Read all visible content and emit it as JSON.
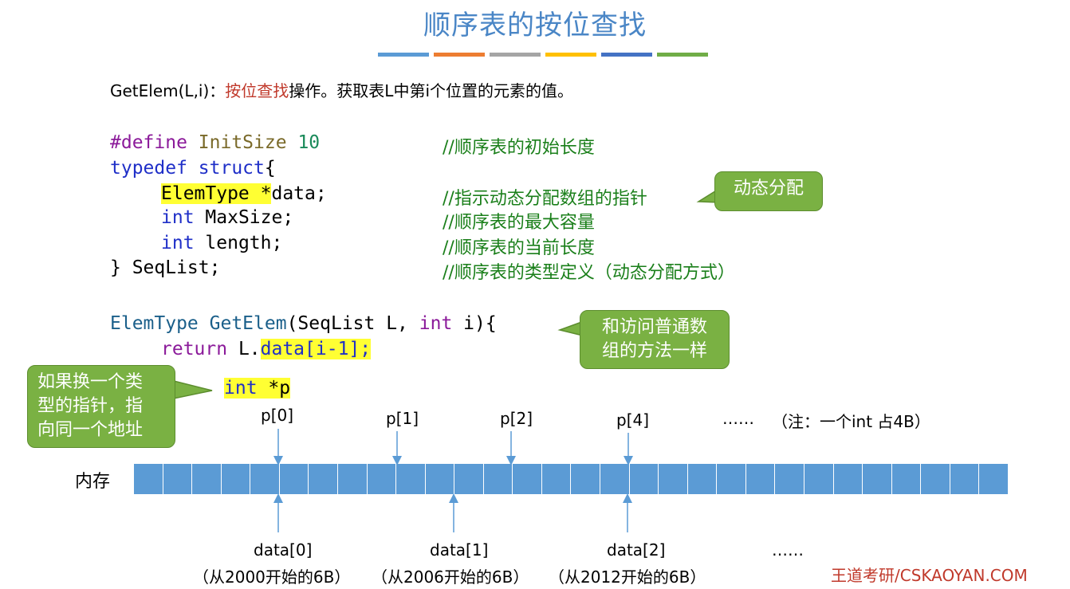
{
  "title": "顺序表的按位查找",
  "title_bar_colors": [
    "#5b9bd5",
    "#ed7d31",
    "#a5a5a5",
    "#ffc000",
    "#4472c4",
    "#70ad47"
  ],
  "getelem_desc": {
    "prefix": "GetElem(L,i)：",
    "highlight": "按位查找",
    "suffix": "操作。获取表L中第i个位置的元素的值。"
  },
  "code": {
    "define_kw": "#define",
    "define_name": "InitSize",
    "define_val": "10",
    "define_cmt": "//顺序表的初始长度",
    "typedef_kw": "typedef",
    "struct_kw": "struct",
    "brace_open": "{",
    "elemtype_decl": "ElemType *",
    "data_member": "data;",
    "data_cmt": "//指示动态分配数组的指针",
    "int_kw": "int",
    "maxsize_member": "MaxSize;",
    "maxsize_cmt": "//顺序表的最大容量",
    "length_member": "length;",
    "length_cmt": "//顺序表的当前长度",
    "seqlist_end": "} SeqList;",
    "seqlist_cmt": "//顺序表的类型定义（动态分配方式）",
    "fn_ret": "ElemType",
    "fn_name": "GetElem",
    "fn_params_a": "(SeqList L, ",
    "fn_params_b": " i){",
    "return_kw": "return",
    "return_l": " L.",
    "return_expr": "data[i-1];",
    "intp_kw": "int",
    "intp_ptr": " *",
    "intp_name": "p"
  },
  "callouts": {
    "dynamic": "动态分配",
    "same_as_array_1": "和访问普通数",
    "same_as_array_2": "组的方法一样",
    "pointer_1": "如果换一个类",
    "pointer_2": "型的指针，指",
    "pointer_3": "向同一个地址"
  },
  "memory_label": "内存",
  "memory_cell_count": 30,
  "pointer_labels": [
    "p[0]",
    "p[1]",
    "p[2]",
    "p[4]"
  ],
  "pointer_ellipsis": "……",
  "pointer_note": "（注：一个int 占4B）",
  "data_labels": [
    "data[0]",
    "data[1]",
    "data[2]"
  ],
  "data_ellipsis": "……",
  "data_notes": [
    "（从2000开始的6B）",
    "（从2006开始的6B）",
    "（从2012开始的6B）"
  ],
  "watermark": "王道考研/CSKAOYAN.COM"
}
